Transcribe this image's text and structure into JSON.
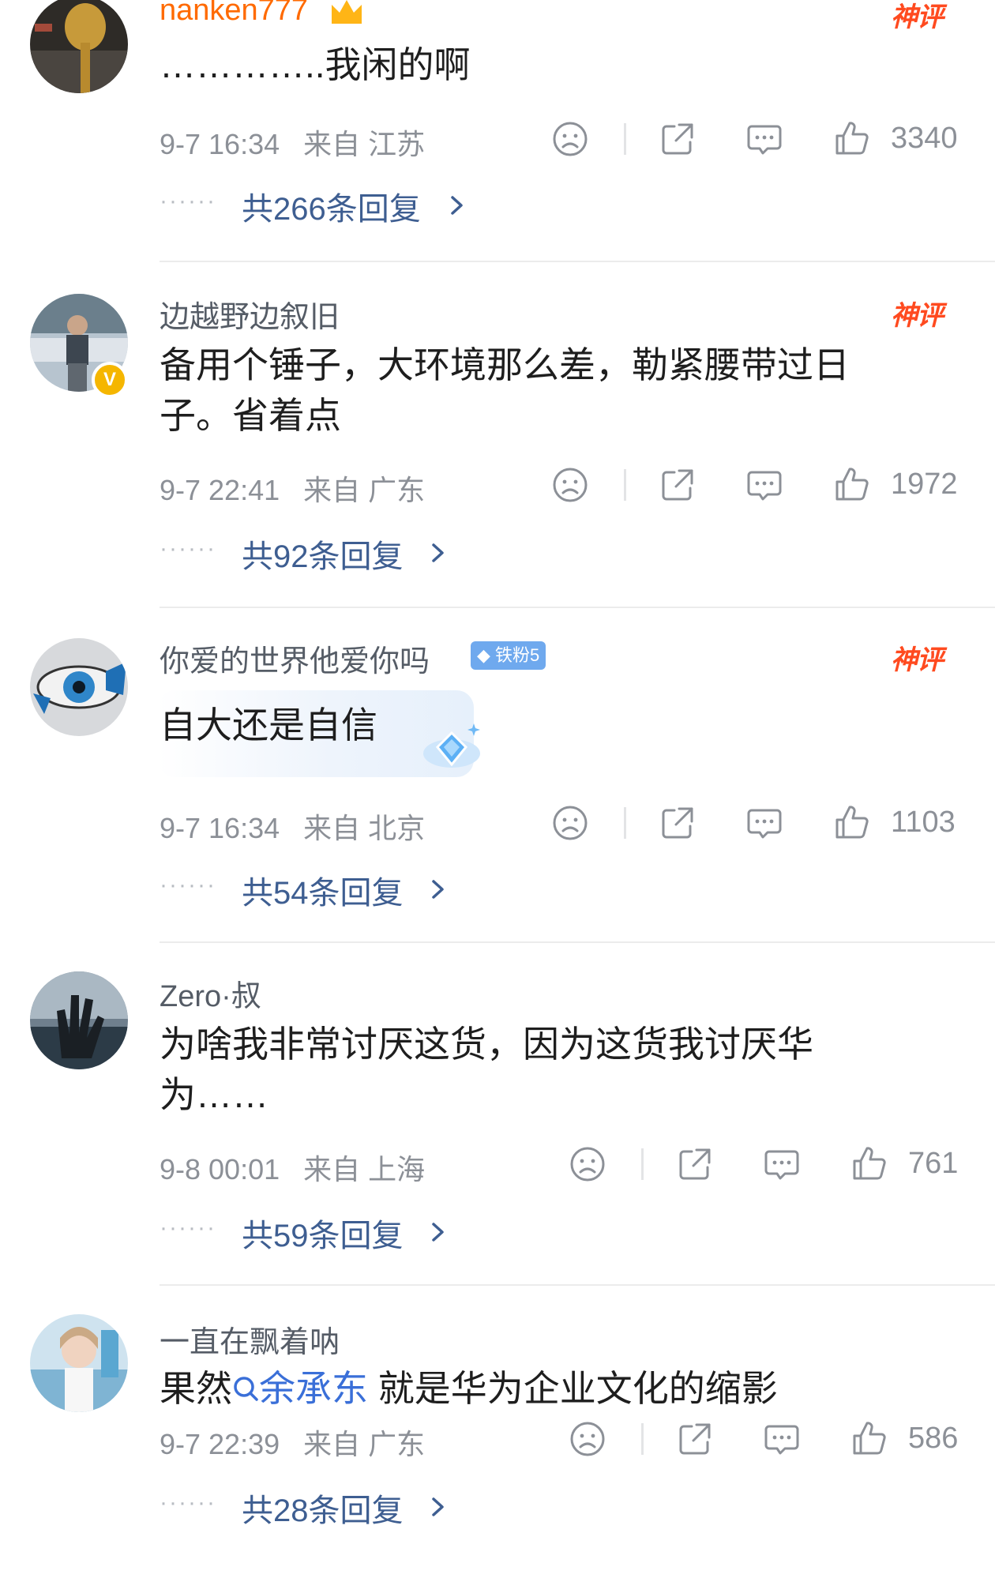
{
  "comments": [
    {
      "username": "nanken777",
      "text": "…………..我闲的啊",
      "time": "9-7 16:34",
      "location": "来自 江苏",
      "likes": "3340",
      "replies": "共266条回复",
      "badge": "神评"
    },
    {
      "username": "边越野边叙旧",
      "text": "备用个锤子，大环境那么差，勒紧腰带过日子。省着点",
      "time": "9-7 22:41",
      "location": "来自 广东",
      "likes": "1972",
      "replies": "共92条回复",
      "badge": "神评"
    },
    {
      "username": "你爱的世界他爱你吗",
      "fan_badge": "铁粉5",
      "text": "自大还是自信",
      "time": "9-7 16:34",
      "location": "来自 北京",
      "likes": "1103",
      "replies": "共54条回复",
      "badge": "神评"
    },
    {
      "username": "Zero·叔",
      "text": "为啥我非常讨厌这货，因为这货我讨厌华为……",
      "time": "9-8 00:01",
      "location": "来自 上海",
      "likes": "761",
      "replies": "共59条回复"
    },
    {
      "username": "一直在飘着呐",
      "text_before": "果然",
      "text_link": "余承东",
      "text_after": " 就是华为企业文化的缩影",
      "time": "9-7 22:39",
      "location": "来自 广东",
      "likes": "586",
      "replies": "共28条回复"
    }
  ],
  "icons": {
    "dislike": "sad-face-icon",
    "share": "share-icon",
    "comment": "comment-bubble-icon",
    "like": "thumbs-up-icon",
    "reply_arrow": "chevron-right-icon"
  },
  "colors": {
    "reply_link": "#3e5e91",
    "shenping": "#ff4a1f",
    "username_vip": "#ff6a00",
    "topic_link": "#3a6fd8",
    "meta": "#8c9097"
  }
}
